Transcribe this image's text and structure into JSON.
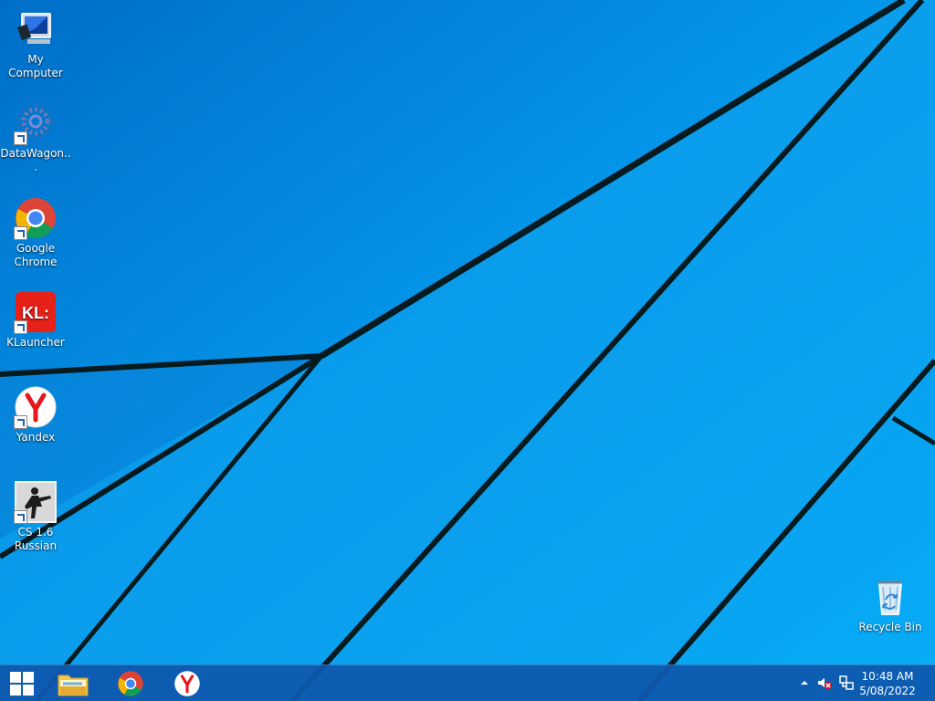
{
  "desktop": {
    "background_colors": {
      "main": "#0a97ea",
      "lines": "#061b1f"
    },
    "icons": [
      {
        "label": "My Computer",
        "icon": "my-computer-icon"
      },
      {
        "label": "DataWagon...",
        "icon": "datawagon-icon"
      },
      {
        "label": "Google Chrome",
        "icon": "chrome-icon"
      },
      {
        "label": "KLauncher",
        "icon": "klauncher-icon"
      },
      {
        "label": "Yandex",
        "icon": "yandex-icon"
      },
      {
        "label": "CS 1.6 Russian",
        "icon": "cs-1-6-russian-icon"
      },
      {
        "label": "Recycle Bin",
        "icon": "recycle-bin-icon"
      }
    ],
    "klauncher_logo_text": "KL:"
  },
  "taskbar": {
    "items": [
      {
        "name": "start-button",
        "icon": "windows-logo-icon"
      },
      {
        "name": "file-explorer",
        "icon": "folder-icon"
      },
      {
        "name": "google-chrome",
        "icon": "chrome-icon"
      },
      {
        "name": "yandex-browser",
        "icon": "yandex-icon"
      }
    ],
    "tray": {
      "icons": [
        "chevron-up-icon",
        "volume-muted-icon",
        "network-icon"
      ],
      "time": "10:48 AM",
      "date": "5/08/2022"
    }
  }
}
